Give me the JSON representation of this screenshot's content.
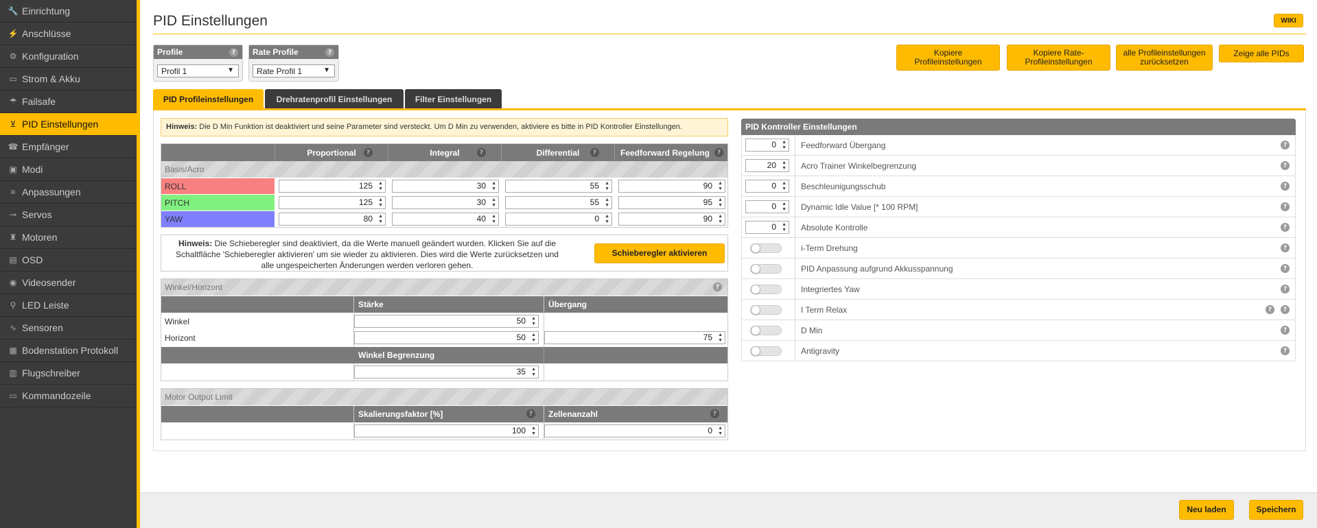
{
  "sidebar": {
    "items": [
      {
        "label": "Einrichtung",
        "icon": "wrench-icon",
        "glyph": "🔧"
      },
      {
        "label": "Anschlüsse",
        "icon": "plug-icon",
        "glyph": "⚡"
      },
      {
        "label": "Konfiguration",
        "icon": "gear-icon",
        "glyph": "⚙"
      },
      {
        "label": "Strom & Akku",
        "icon": "battery-icon",
        "glyph": "▭"
      },
      {
        "label": "Failsafe",
        "icon": "parachute-icon",
        "glyph": "☂"
      },
      {
        "label": "PID Einstellungen",
        "icon": "hierarchy-icon",
        "glyph": "⊻"
      },
      {
        "label": "Empfänger",
        "icon": "receiver-icon",
        "glyph": "☎"
      },
      {
        "label": "Modi",
        "icon": "modes-icon",
        "glyph": "▣"
      },
      {
        "label": "Anpassungen",
        "icon": "sliders-icon",
        "glyph": "≡"
      },
      {
        "label": "Servos",
        "icon": "servo-icon",
        "glyph": "⊸"
      },
      {
        "label": "Motoren",
        "icon": "motor-icon",
        "glyph": "♜"
      },
      {
        "label": "OSD",
        "icon": "osd-icon",
        "glyph": "▤"
      },
      {
        "label": "Videosender",
        "icon": "broadcast-icon",
        "glyph": "◉"
      },
      {
        "label": "LED Leiste",
        "icon": "led-icon",
        "glyph": "⚲"
      },
      {
        "label": "Sensoren",
        "icon": "pulse-icon",
        "glyph": "∿"
      },
      {
        "label": "Bodenstation Protokoll",
        "icon": "log-icon",
        "glyph": "▦"
      },
      {
        "label": "Flugschreiber",
        "icon": "recorder-icon",
        "glyph": "▥"
      },
      {
        "label": "Kommandozeile",
        "icon": "terminal-icon",
        "glyph": "▭"
      }
    ],
    "active_index": 5
  },
  "header": {
    "title": "PID Einstellungen",
    "wiki": "WIKI"
  },
  "profile": {
    "label": "Profile",
    "selected": "Profil 1"
  },
  "rate_profile": {
    "label": "Rate Profile",
    "selected": "Rate Profil 1"
  },
  "buttons": {
    "copy_profile": "Kopiere Profileinstellungen",
    "copy_rate_profile": "Kopiere Rate-Profileinstellungen",
    "reset_all": "alle Profileinstellungen zurücksetzen",
    "show_all": "Zeige alle PIDs"
  },
  "tabs": [
    "PID Profileinstellungen",
    "Drehratenprofil Einstellungen",
    "Filter Einstellungen"
  ],
  "hint_dmin": {
    "strong": "Hinweis:",
    "text": " Die D Min Funktion ist deaktiviert und seine Parameter sind versteckt. Um D Min zu verwenden, aktiviere es bitte in PID Kontroller Einstellungen."
  },
  "pid_table": {
    "headers": [
      "Proportional",
      "Integral",
      "Differential",
      "Feedforward Regelung"
    ],
    "section": "Basis/Acro",
    "rows": [
      {
        "name": "ROLL",
        "color": "#f88080",
        "values": [
          "125",
          "30",
          "55",
          "90"
        ]
      },
      {
        "name": "PITCH",
        "color": "#80f080",
        "values": [
          "125",
          "30",
          "55",
          "95"
        ]
      },
      {
        "name": "YAW",
        "color": "#8080ff",
        "values": [
          "80",
          "40",
          "0",
          "90"
        ]
      }
    ]
  },
  "slider_hint": {
    "strong": "Hinweis:",
    "line1": " Die Schieberegler sind deaktiviert, da die Werte manuell geändert wurden. Klicken Sie auf die",
    "line2": "Schaltfläche 'Schieberegler aktivieren' um sie wieder zu aktivieren. Dies wird die Werte zurücksetzen und",
    "line3": "alle ungespeicherten Änderungen werden verloren gehen.",
    "button": "Schieberegler aktivieren"
  },
  "angle": {
    "section": "Winkel/Horizont",
    "col_strength": "Stärke",
    "col_transition": "Übergang",
    "row_angle": "Winkel",
    "row_horizon": "Horizont",
    "angle_strength": "50",
    "horizon_strength": "50",
    "horizon_transition": "75",
    "limit_label": "Winkel Begrenzung",
    "limit_value": "35"
  },
  "motor": {
    "section": "Motor Output Limit",
    "col_scale": "Skalierungsfaktor [%]",
    "col_cells": "Zellenanzahl",
    "scale_value": "100",
    "cells_value": "0"
  },
  "controller": {
    "title": "PID Kontroller Einstellungen",
    "number_rows": [
      {
        "label": "Feedforward Übergang",
        "value": "0"
      },
      {
        "label": "Acro Trainer Winkelbegrenzung",
        "value": "20"
      },
      {
        "label": "Beschleunigungsschub",
        "value": "0"
      },
      {
        "label": "Dynamic Idle Value [* 100 RPM]",
        "value": "0"
      },
      {
        "label": "Absolute Kontrolle",
        "value": "0"
      }
    ],
    "toggle_rows": [
      {
        "label": "i-Term Drehung"
      },
      {
        "label": "PID Anpassung aufgrund Akkusspannung"
      },
      {
        "label": "Integriertes Yaw"
      },
      {
        "label": "I Term Relax"
      },
      {
        "label": "D Min"
      },
      {
        "label": "Antigravity"
      }
    ]
  },
  "footer": {
    "reload": "Neu laden",
    "save": "Speichern"
  },
  "colors": {
    "accent": "#ffbb00",
    "sidebar": "#3b3b3b",
    "header": "#7a7a7a"
  }
}
